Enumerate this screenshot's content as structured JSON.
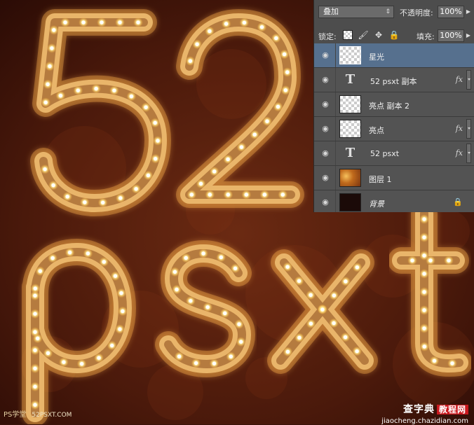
{
  "layers_panel": {
    "blend_mode": "叠加",
    "opacity_label": "不透明度:",
    "opacity_value": "100%",
    "lock_label": "锁定:",
    "fill_label": "填充:",
    "fill_value": "100%",
    "layers": [
      {
        "name": "星光",
        "thumb": "transparent",
        "selected": true,
        "fx": false
      },
      {
        "name": "52 psxt 副本",
        "thumb": "text",
        "selected": false,
        "fx": true
      },
      {
        "name": "亮点 副本 2",
        "thumb": "transparent",
        "selected": false,
        "fx": false
      },
      {
        "name": "亮点",
        "thumb": "transparent",
        "selected": false,
        "fx": true
      },
      {
        "name": "52 psxt",
        "thumb": "text",
        "selected": false,
        "fx": true
      },
      {
        "name": "图层 1",
        "thumb": "glitter",
        "selected": false,
        "fx": false
      },
      {
        "name": "背景",
        "thumb": "dark",
        "selected": false,
        "fx": false,
        "locked": true
      }
    ],
    "fx_label": "fx",
    "text_thumb_glyph": "T"
  },
  "artwork": {
    "row1_text": "52",
    "row2_text": "psxt",
    "colors": {
      "background": "#3a140a",
      "tube": "#e9b56a",
      "bulb": "#fff3b0",
      "glow": "#ffb23a"
    }
  },
  "watermarks": {
    "left_brand": "PS学堂",
    "left_url": "52PSXT.COM",
    "right_brand": "查字典",
    "right_tag": "教程网",
    "right_url": "jiaocheng.chazidian.com"
  }
}
